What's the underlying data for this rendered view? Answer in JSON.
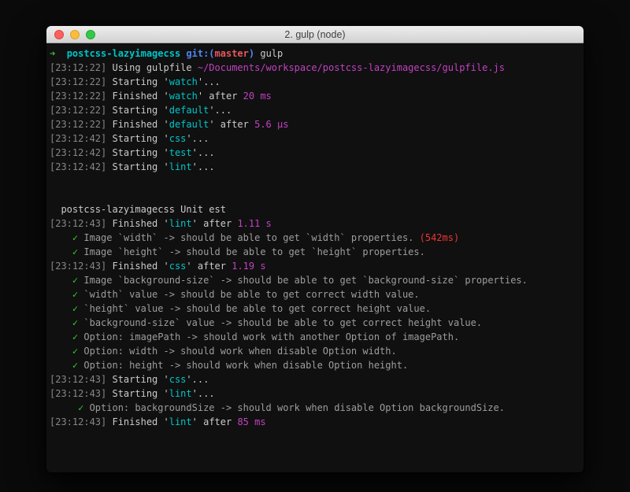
{
  "window": {
    "title": "2. gulp (node)",
    "controls": {
      "close": "close",
      "minimize": "minimize",
      "zoom": "zoom"
    }
  },
  "colors": {
    "gray": "#878787",
    "fg": "#cbcbcb",
    "cyan": "#00c5c7",
    "magenta": "#c241c2",
    "green": "#32cd32",
    "pgreen": "#3fba3f",
    "blue": "#4f86f7",
    "red": "#e8575c",
    "tred": "#ef3434",
    "tgray": "#9d9d9d",
    "titlebar_bg": "#e0e0e0",
    "terminal_bg": "#101010",
    "light_red": "#fc615d",
    "light_yellow": "#fdbc40",
    "light_green": "#34c749"
  },
  "terminal": {
    "lines": [
      [
        {
          "t": "➜  ",
          "c": "pgreen",
          "b": 1
        },
        {
          "t": "postcss-lazyimagecss ",
          "c": "cyan",
          "b": 1
        },
        {
          "t": "git:(",
          "c": "blue",
          "b": 1
        },
        {
          "t": "master",
          "c": "red",
          "b": 1
        },
        {
          "t": ") ",
          "c": "blue",
          "b": 1
        },
        {
          "t": "gulp",
          "c": "fg"
        }
      ],
      [
        {
          "t": "[23:12:22] ",
          "c": "gray"
        },
        {
          "t": "Using gulpfile ",
          "c": "fg"
        },
        {
          "t": "~/Documents/workspace/postcss-lazyimagecss/gulpfile.js",
          "c": "magenta"
        }
      ],
      [
        {
          "t": "[23:12:22] ",
          "c": "gray"
        },
        {
          "t": "Starting '",
          "c": "fg"
        },
        {
          "t": "watch",
          "c": "cyan"
        },
        {
          "t": "'...",
          "c": "fg"
        }
      ],
      [
        {
          "t": "[23:12:22] ",
          "c": "gray"
        },
        {
          "t": "Finished '",
          "c": "fg"
        },
        {
          "t": "watch",
          "c": "cyan"
        },
        {
          "t": "' after ",
          "c": "fg"
        },
        {
          "t": "20 ms",
          "c": "magenta"
        }
      ],
      [
        {
          "t": "[23:12:22] ",
          "c": "gray"
        },
        {
          "t": "Starting '",
          "c": "fg"
        },
        {
          "t": "default",
          "c": "cyan"
        },
        {
          "t": "'...",
          "c": "fg"
        }
      ],
      [
        {
          "t": "[23:12:22] ",
          "c": "gray"
        },
        {
          "t": "Finished '",
          "c": "fg"
        },
        {
          "t": "default",
          "c": "cyan"
        },
        {
          "t": "' after ",
          "c": "fg"
        },
        {
          "t": "5.6 µs",
          "c": "magenta"
        }
      ],
      [
        {
          "t": "[23:12:42] ",
          "c": "gray"
        },
        {
          "t": "Starting '",
          "c": "fg"
        },
        {
          "t": "css",
          "c": "cyan"
        },
        {
          "t": "'...",
          "c": "fg"
        }
      ],
      [
        {
          "t": "[23:12:42] ",
          "c": "gray"
        },
        {
          "t": "Starting '",
          "c": "fg"
        },
        {
          "t": "test",
          "c": "cyan"
        },
        {
          "t": "'...",
          "c": "fg"
        }
      ],
      [
        {
          "t": "[23:12:42] ",
          "c": "gray"
        },
        {
          "t": "Starting '",
          "c": "fg"
        },
        {
          "t": "lint",
          "c": "cyan"
        },
        {
          "t": "'...",
          "c": "fg"
        }
      ],
      [],
      [],
      [
        {
          "t": "  postcss-lazyimagecss Unit est",
          "c": "fg"
        }
      ],
      [
        {
          "t": "[23:12:43] ",
          "c": "gray"
        },
        {
          "t": "Finished '",
          "c": "fg"
        },
        {
          "t": "lint",
          "c": "cyan"
        },
        {
          "t": "' after ",
          "c": "fg"
        },
        {
          "t": "1.11 s",
          "c": "magenta"
        }
      ],
      [
        {
          "t": "    ",
          "c": "fg"
        },
        {
          "t": "✓",
          "c": "green"
        },
        {
          "t": " Image `width` -> should be able to get `width` properties. ",
          "c": "tgray"
        },
        {
          "t": "(542ms)",
          "c": "tred"
        }
      ],
      [
        {
          "t": "    ",
          "c": "fg"
        },
        {
          "t": "✓",
          "c": "green"
        },
        {
          "t": " Image `height` -> should be able to get `height` properties.",
          "c": "tgray"
        }
      ],
      [
        {
          "t": "[23:12:43] ",
          "c": "gray"
        },
        {
          "t": "Finished '",
          "c": "fg"
        },
        {
          "t": "css",
          "c": "cyan"
        },
        {
          "t": "' after ",
          "c": "fg"
        },
        {
          "t": "1.19 s",
          "c": "magenta"
        }
      ],
      [
        {
          "t": "    ",
          "c": "fg"
        },
        {
          "t": "✓",
          "c": "green"
        },
        {
          "t": " Image `background-size` -> should be able to get `background-size` properties.",
          "c": "tgray"
        }
      ],
      [
        {
          "t": "    ",
          "c": "fg"
        },
        {
          "t": "✓",
          "c": "green"
        },
        {
          "t": " `width` value -> should be able to get correct width value.",
          "c": "tgray"
        }
      ],
      [
        {
          "t": "    ",
          "c": "fg"
        },
        {
          "t": "✓",
          "c": "green"
        },
        {
          "t": " `height` value -> should be able to get correct height value.",
          "c": "tgray"
        }
      ],
      [
        {
          "t": "    ",
          "c": "fg"
        },
        {
          "t": "✓",
          "c": "green"
        },
        {
          "t": " `background-size` value -> should be able to get correct height value.",
          "c": "tgray"
        }
      ],
      [
        {
          "t": "    ",
          "c": "fg"
        },
        {
          "t": "✓",
          "c": "green"
        },
        {
          "t": " Option: imagePath -> should work with another Option of imagePath.",
          "c": "tgray"
        }
      ],
      [
        {
          "t": "    ",
          "c": "fg"
        },
        {
          "t": "✓",
          "c": "green"
        },
        {
          "t": " Option: width -> should work when disable Option width.",
          "c": "tgray"
        }
      ],
      [
        {
          "t": "    ",
          "c": "fg"
        },
        {
          "t": "✓",
          "c": "green"
        },
        {
          "t": " Option: height -> should work when disable Option height.",
          "c": "tgray"
        }
      ],
      [
        {
          "t": "[23:12:43] ",
          "c": "gray"
        },
        {
          "t": "Starting '",
          "c": "fg"
        },
        {
          "t": "css",
          "c": "cyan"
        },
        {
          "t": "'...",
          "c": "fg"
        }
      ],
      [
        {
          "t": "[23:12:43] ",
          "c": "gray"
        },
        {
          "t": "Starting '",
          "c": "fg"
        },
        {
          "t": "lint",
          "c": "cyan"
        },
        {
          "t": "'...",
          "c": "fg"
        }
      ],
      [
        {
          "t": "     ",
          "c": "fg"
        },
        {
          "t": "✓",
          "c": "green"
        },
        {
          "t": " Option: backgroundSize -> should work when disable Option backgroundSize.",
          "c": "tgray"
        }
      ],
      [
        {
          "t": "[23:12:43] ",
          "c": "gray"
        },
        {
          "t": "Finished '",
          "c": "fg"
        },
        {
          "t": "lint",
          "c": "cyan"
        },
        {
          "t": "' after ",
          "c": "fg"
        },
        {
          "t": "85 ms",
          "c": "magenta"
        }
      ]
    ]
  }
}
